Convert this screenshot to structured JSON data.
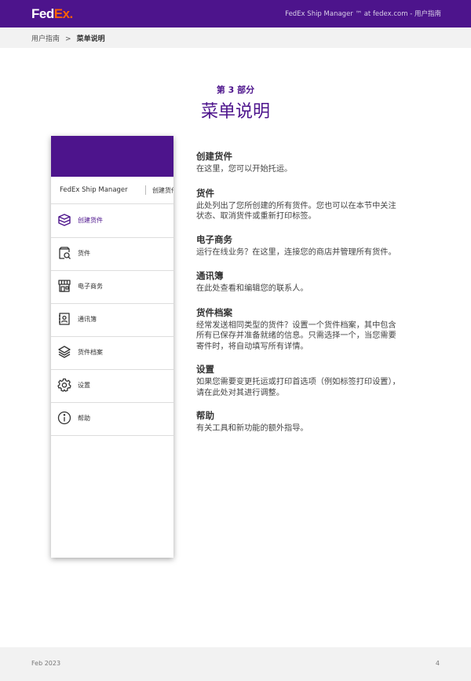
{
  "header": {
    "logo_fed": "Fed",
    "logo_ex": "Ex.",
    "title": "FedEx Ship Manager ™ at fedex.com - 用户指南"
  },
  "breadcrumb": {
    "items": [
      "用户指南",
      "菜单说明"
    ],
    "separator": ">"
  },
  "section": {
    "label": "第 3 部分",
    "title": "菜单说明"
  },
  "mockup": {
    "app_name": "FedEx Ship Manager",
    "tab": "创建货件",
    "menu": [
      {
        "label": "创建货件",
        "icon": "box-icon",
        "active": true
      },
      {
        "label": "货件",
        "icon": "package-search-icon",
        "active": false
      },
      {
        "label": "电子商务",
        "icon": "storefront-icon",
        "active": false
      },
      {
        "label": "通讯簿",
        "icon": "address-book-icon",
        "active": false
      },
      {
        "label": "货件档案",
        "icon": "layers-icon",
        "active": false
      },
      {
        "label": "设置",
        "icon": "gear-icon",
        "active": false
      },
      {
        "label": "帮助",
        "icon": "info-icon",
        "active": false
      }
    ]
  },
  "descriptions": [
    {
      "title": "创建货件",
      "lines": [
        "在这里，您可以开始托运。"
      ]
    },
    {
      "title": "货件",
      "lines": [
        "此处列出了您所创建的所有货件。您也可以在本节中关注",
        "状态、取消货件或重新打印标签。"
      ]
    },
    {
      "title": "电子商务",
      "lines": [
        "运行在线业务？在这里，连接您的商店并管理所有货件。"
      ]
    },
    {
      "title": "通讯簿",
      "lines": [
        "在此处查看和编辑您的联系人。"
      ]
    },
    {
      "title": "货件档案",
      "lines": [
        "经常发送相同类型的货件？设置一个货件档案，其中包含",
        "所有已保存并准备就绪的信息。只需选择一个，当您需要",
        "寄件时，将自动填写所有详情。"
      ]
    },
    {
      "title": "设置",
      "lines": [
        "如果您需要变更托运或打印首选项（例如标签打印设置），",
        "请在此处对其进行调整。"
      ]
    },
    {
      "title": "帮助",
      "lines": [
        "有关工具和新功能的额外指导。"
      ]
    }
  ],
  "footer": {
    "date": "Feb 2023",
    "page": "4"
  },
  "colors": {
    "brand_purple": "#4d148c",
    "brand_orange": "#ff6200",
    "band_gray": "#f2f2f2"
  }
}
